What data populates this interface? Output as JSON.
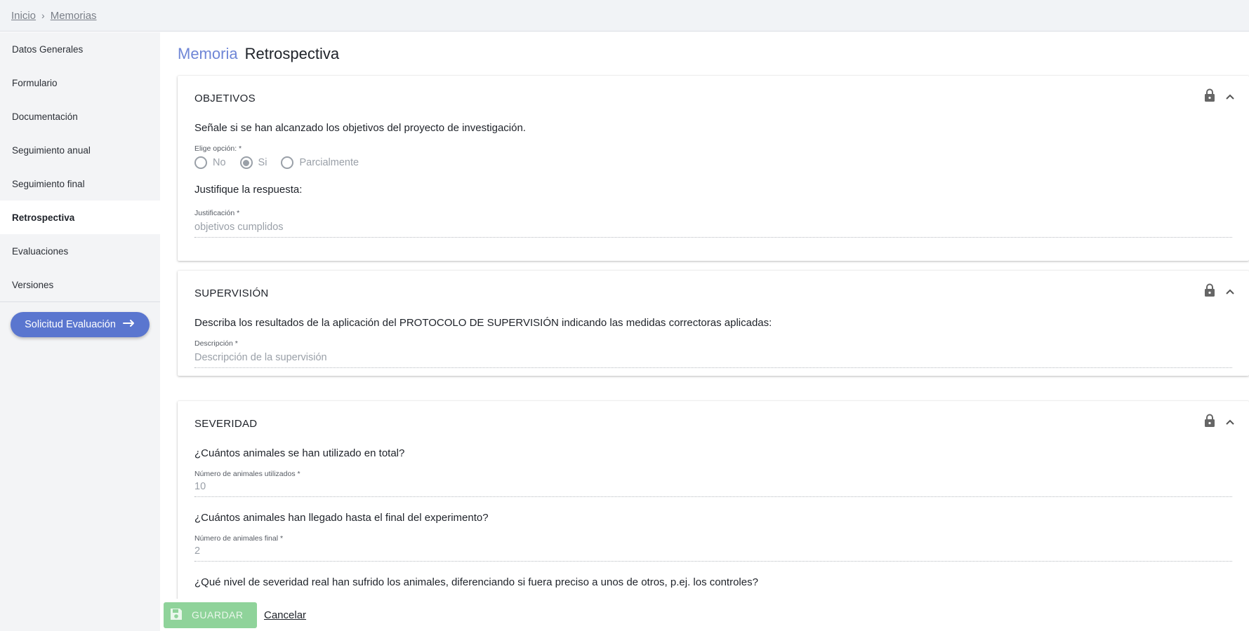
{
  "breadcrumb": {
    "home": "Inicio",
    "separator": "›",
    "current": "Memorias"
  },
  "sidebar": {
    "items": [
      {
        "label": "Datos Generales"
      },
      {
        "label": "Formulario"
      },
      {
        "label": "Documentación"
      },
      {
        "label": "Seguimiento anual"
      },
      {
        "label": "Seguimiento final"
      },
      {
        "label": "Retrospectiva",
        "active": true
      },
      {
        "label": "Evaluaciones"
      },
      {
        "label": "Versiones"
      }
    ],
    "action_button": {
      "label": "Solicitud Evaluación",
      "icon": "arrow-right-icon"
    }
  },
  "page": {
    "title_prefix": "Memoria",
    "title": "Retrospectiva"
  },
  "sections": {
    "objetivos": {
      "title": "OBJETIVOS",
      "question": "Señale si se han alcanzado los objetivos del proyecto de investigación.",
      "option_label": "Elige opción: *",
      "options": [
        "No",
        "Si",
        "Parcialmente"
      ],
      "selected": "Si",
      "justify_question": "Justifique la respuesta:",
      "justify_label": "Justificación *",
      "justify_value": "objetivos cumplidos"
    },
    "supervision": {
      "title": "SUPERVISIÓN",
      "question": "Describa los resultados de la aplicación del PROTOCOLO DE SUPERVISIÓN indicando las medidas correctoras aplicadas:",
      "field_label": "Descripción *",
      "field_placeholder": "Descripción de la supervisión"
    },
    "severidad": {
      "title": "SEVERIDAD",
      "q1": "¿Cuántos animales se han utilizado en total?",
      "q1_label": "Número de animales utilizados *",
      "q1_value": "10",
      "q2": "¿Cuántos animales han llegado hasta el final del experimento?",
      "q2_label": "Número de animales final *",
      "q2_value": "2",
      "q3": "¿Qué nivel de severidad real han sufrido los animales, diferenciando si fuera preciso a unos de otros, p.ej. los controles?"
    }
  },
  "footer": {
    "save_label": "GUARDAR",
    "cancel_label": "Cancelar"
  },
  "colors": {
    "accent": "#5a76cf",
    "title_accent": "#6f86d6",
    "save_green": "#8fd39a"
  }
}
